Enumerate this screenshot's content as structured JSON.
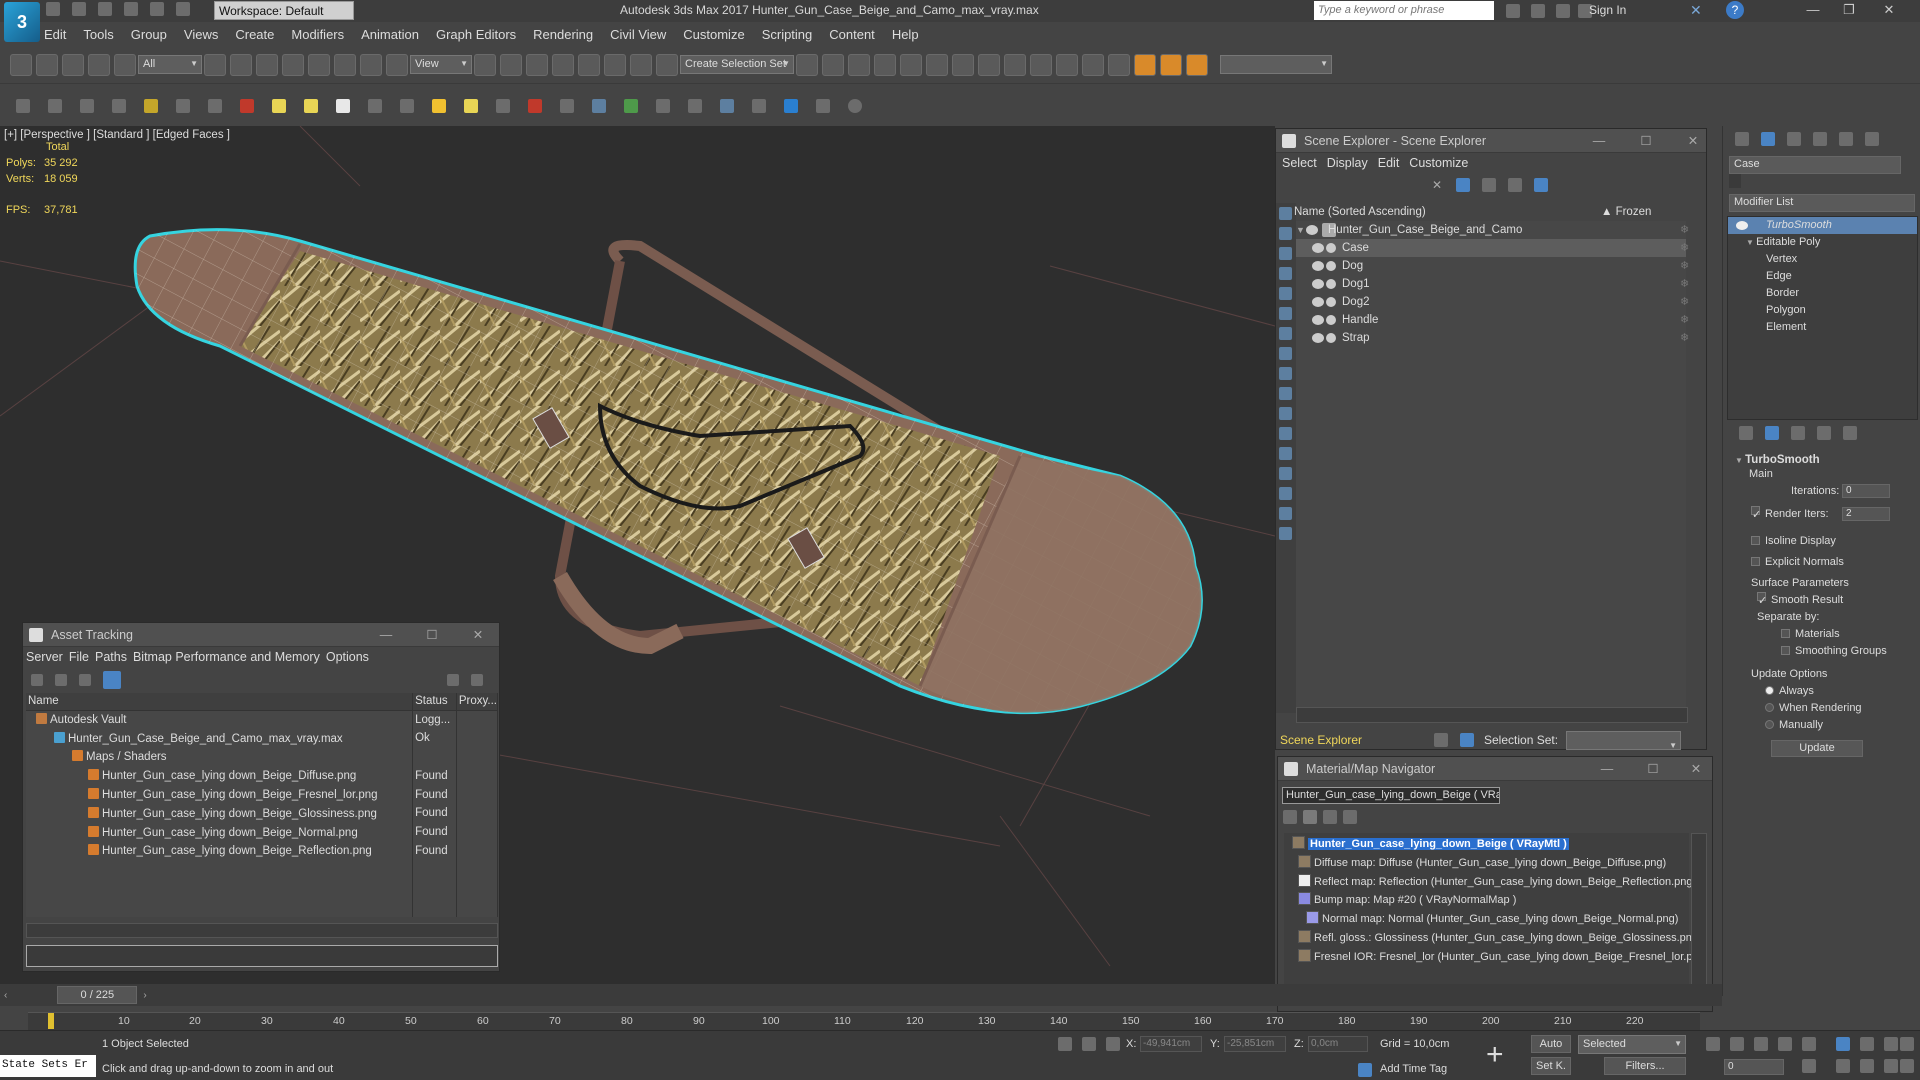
{
  "app": {
    "title": "Autodesk 3ds Max 2017     Hunter_Gun_Case_Beige_and_Camo_max_vray.max",
    "workspace": "Workspace: Default",
    "search_placeholder": "Type a keyword or phrase",
    "sign_in": "Sign In"
  },
  "menu": [
    "Edit",
    "Tools",
    "Group",
    "Views",
    "Create",
    "Modifiers",
    "Animation",
    "Graph Editors",
    "Rendering",
    "Civil View",
    "Customize",
    "Scripting",
    "Content",
    "Help"
  ],
  "toolbar": {
    "filter_value": "All",
    "ref_coord": "View",
    "selection_set": "Create Selection Set"
  },
  "viewport": {
    "label": "[+] [Perspective ] [Standard ] [Edged Faces ]",
    "stats_header": "Total",
    "polys_label": "Polys:",
    "polys_value": "35 292",
    "verts_label": "Verts:",
    "verts_value": "18 059",
    "fps_label": "FPS:",
    "fps_value": "37,781"
  },
  "scene_explorer": {
    "title": "Scene Explorer - Scene Explorer",
    "menu": [
      "Select",
      "Display",
      "Edit",
      "Customize"
    ],
    "col_name": "Name (Sorted Ascending)",
    "col_frozen": "▲ Frozen",
    "root": "Hunter_Gun_Case_Beige_and_Camo",
    "children": [
      "Case",
      "Dog",
      "Dog1",
      "Dog2",
      "Handle",
      "Strap"
    ],
    "footer_label": "Scene Explorer",
    "selection_set_label": "Selection Set:"
  },
  "command_panel": {
    "object_name": "Case",
    "modifier_list": "Modifier List",
    "stack": {
      "turbosmooth": "TurboSmooth",
      "editable_poly": "Editable Poly",
      "subs": [
        "Vertex",
        "Edge",
        "Border",
        "Polygon",
        "Element"
      ]
    },
    "rollout_title": "TurboSmooth",
    "main": "Main",
    "iterations_label": "Iterations:",
    "iterations_value": "0",
    "render_iters_label": "Render Iters:",
    "render_iters_value": "2",
    "isoline": "Isoline Display",
    "explicit": "Explicit Normals",
    "surface_params": "Surface Parameters",
    "smooth_result": "Smooth Result",
    "separate_by": "Separate by:",
    "materials": "Materials",
    "smoothing_groups": "Smoothing Groups",
    "update_options": "Update Options",
    "always": "Always",
    "when_rendering": "When Rendering",
    "manually": "Manually",
    "update_btn": "Update"
  },
  "asset_tracking": {
    "title": "Asset Tracking",
    "menu": [
      "Server",
      "File",
      "Paths",
      "Bitmap Performance and Memory",
      "Options"
    ],
    "columns": [
      "Name",
      "Status",
      "Proxy..."
    ],
    "rows": [
      {
        "name": "Autodesk Vault",
        "status": "Logg..."
      },
      {
        "name": "Hunter_Gun_Case_Beige_and_Camo_max_vray.max",
        "status": "Ok"
      },
      {
        "name": "Maps / Shaders",
        "status": ""
      },
      {
        "name": "Hunter_Gun_case_lying down_Beige_Diffuse.png",
        "status": "Found"
      },
      {
        "name": "Hunter_Gun_case_lying down_Beige_Fresnel_lor.png",
        "status": "Found"
      },
      {
        "name": "Hunter_Gun_case_lying down_Beige_Glossiness.png",
        "status": "Found"
      },
      {
        "name": "Hunter_Gun_case_lying down_Beige_Normal.png",
        "status": "Found"
      },
      {
        "name": "Hunter_Gun_case_lying down_Beige_Reflection.png",
        "status": "Found"
      }
    ]
  },
  "material_navigator": {
    "title": "Material/Map Navigator",
    "field": "Hunter_Gun_case_lying_down_Beige  ( VRayf",
    "items": [
      "Hunter_Gun_case_lying_down_Beige  ( VRayMtl )",
      "Diffuse map: Diffuse (Hunter_Gun_case_lying down_Beige_Diffuse.png)",
      "Reflect map: Reflection (Hunter_Gun_case_lying down_Beige_Reflection.png)",
      "Bump map: Map #20  ( VRayNormalMap )",
      "Normal map: Normal (Hunter_Gun_case_lying down_Beige_Normal.png)",
      "Refl. gloss.: Glossiness (Hunter_Gun_case_lying down_Beige_Glossiness.png)",
      "Fresnel IOR: Fresnel_lor (Hunter_Gun_case_lying down_Beige_Fresnel_lor.png"
    ]
  },
  "timeline": {
    "frame": "0 / 225",
    "ticks": [
      "10",
      "20",
      "30",
      "40",
      "50",
      "60",
      "70",
      "80",
      "90",
      "100",
      "110",
      "120",
      "130",
      "140",
      "150",
      "160",
      "170",
      "180",
      "190",
      "200",
      "210",
      "220"
    ]
  },
  "status": {
    "maxscript": "State Sets Er",
    "selection": "1 Object Selected",
    "prompt": "Click and drag up-and-down to zoom in and out",
    "x_label": "X:",
    "x_value": "-49,941cm",
    "y_label": "Y:",
    "y_value": "-25,851cm",
    "z_label": "Z:",
    "z_value": "0,0cm",
    "grid": "Grid = 10,0cm",
    "add_time_tag": "Add Time Tag",
    "auto": "Auto",
    "set_k": "Set K.",
    "selected": "Selected",
    "filters": "Filters...",
    "frame_value": "0"
  }
}
